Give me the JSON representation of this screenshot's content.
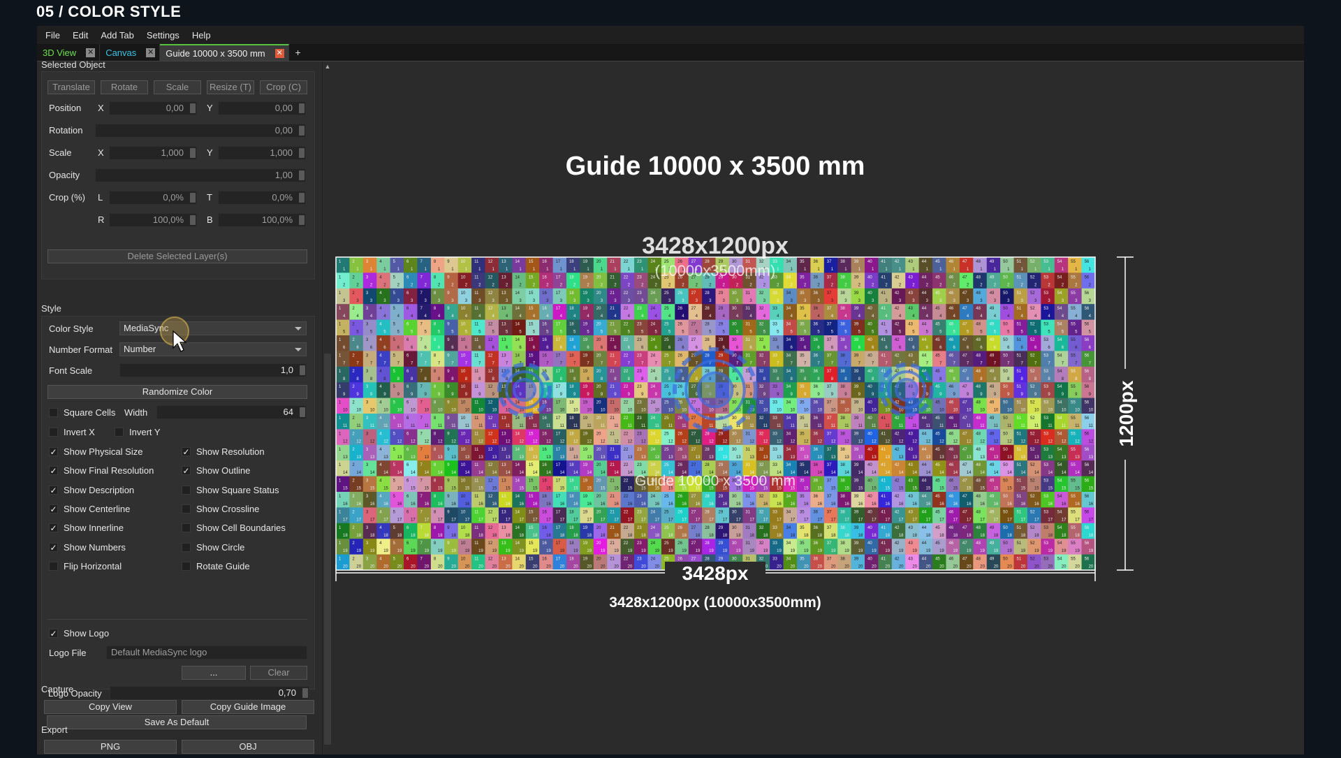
{
  "page_title": "05 / COLOR STYLE",
  "menu": [
    "File",
    "Edit",
    "Add Tab",
    "Settings",
    "Help"
  ],
  "tabs": [
    {
      "label": "3D View",
      "style": "green"
    },
    {
      "label": "Canvas",
      "style": "cyan"
    },
    {
      "label": "Guide 10000 x 3500 mm",
      "style": "active"
    }
  ],
  "tab_add": "+",
  "selected_object": {
    "header": "Selected Object",
    "tools": [
      "Translate",
      "Rotate",
      "Scale",
      "Resize (T)",
      "Crop (C)"
    ],
    "position_label": "Position",
    "position_x": "0,00",
    "position_y": "0,00",
    "rotation_label": "Rotation",
    "rotation": "0,00",
    "scale_label": "Scale",
    "scale_x": "1,000",
    "scale_y": "1,000",
    "opacity_label": "Opacity",
    "opacity": "1,00",
    "crop_label": "Crop (%)",
    "crop_l": "0,0%",
    "crop_t": "0,0%",
    "crop_r": "100,0%",
    "crop_b": "100,0%",
    "axis_x": "X",
    "axis_y": "Y",
    "axis_l": "L",
    "axis_t": "T",
    "axis_r": "R",
    "axis_b": "B",
    "delete_label": "Delete Selected Layer(s)"
  },
  "style": {
    "header": "Style",
    "color_style_label": "Color Style",
    "color_style_value": "MediaSync",
    "number_format_label": "Number Format",
    "number_format_value": "Number",
    "font_scale_label": "Font Scale",
    "font_scale_value": "1,0",
    "randomize_label": "Randomize Color",
    "square_cells_label": "Square Cells",
    "width_label": "Width",
    "width_value": "64",
    "invert_x_label": "Invert X",
    "invert_y_label": "Invert Y",
    "checks_left": [
      {
        "label": "Show Physical Size",
        "checked": true
      },
      {
        "label": "Show Final Resolution",
        "checked": true
      },
      {
        "label": "Show Description",
        "checked": true
      },
      {
        "label": "Show Centerline",
        "checked": true
      },
      {
        "label": "Show Innerline",
        "checked": true
      },
      {
        "label": "Show Numbers",
        "checked": true
      },
      {
        "label": "Flip Horizontal",
        "checked": false
      }
    ],
    "checks_right": [
      {
        "label": "Show Resolution",
        "checked": true
      },
      {
        "label": "Show Outline",
        "checked": true
      },
      {
        "label": "Show Square Status",
        "checked": false
      },
      {
        "label": "Show Crossline",
        "checked": false
      },
      {
        "label": "Show Cell Boundaries",
        "checked": false
      },
      {
        "label": "Show Circle",
        "checked": false
      },
      {
        "label": "Rotate Guide",
        "checked": false
      }
    ],
    "show_logo_label": "Show Logo",
    "logo_file_label": "Logo File",
    "logo_file_value": "Default MediaSync logo",
    "browse_label": "...",
    "clear_label": "Clear",
    "logo_opacity_label": "Logo Opacity",
    "logo_opacity_value": "0,70",
    "save_default_label": "Save As Default"
  },
  "capture": {
    "header": "Capture",
    "copy_view_label": "Copy View",
    "copy_guide_label": "Copy Guide Image"
  },
  "export": {
    "header": "Export",
    "png_label": "PNG",
    "obj_label": "OBJ"
  },
  "guide": {
    "title": "Guide 10000 x 3500 mm",
    "overlay_resolution": "3428x1200px",
    "overlay_physical": "(10000x3500mm)",
    "overlay_description": "Guide 10000 x 3500 mm",
    "width_label": "3428px",
    "height_label": "1200px",
    "footer": "3428x1200px (10000x3500mm)",
    "columns": 56,
    "rows": 20
  }
}
